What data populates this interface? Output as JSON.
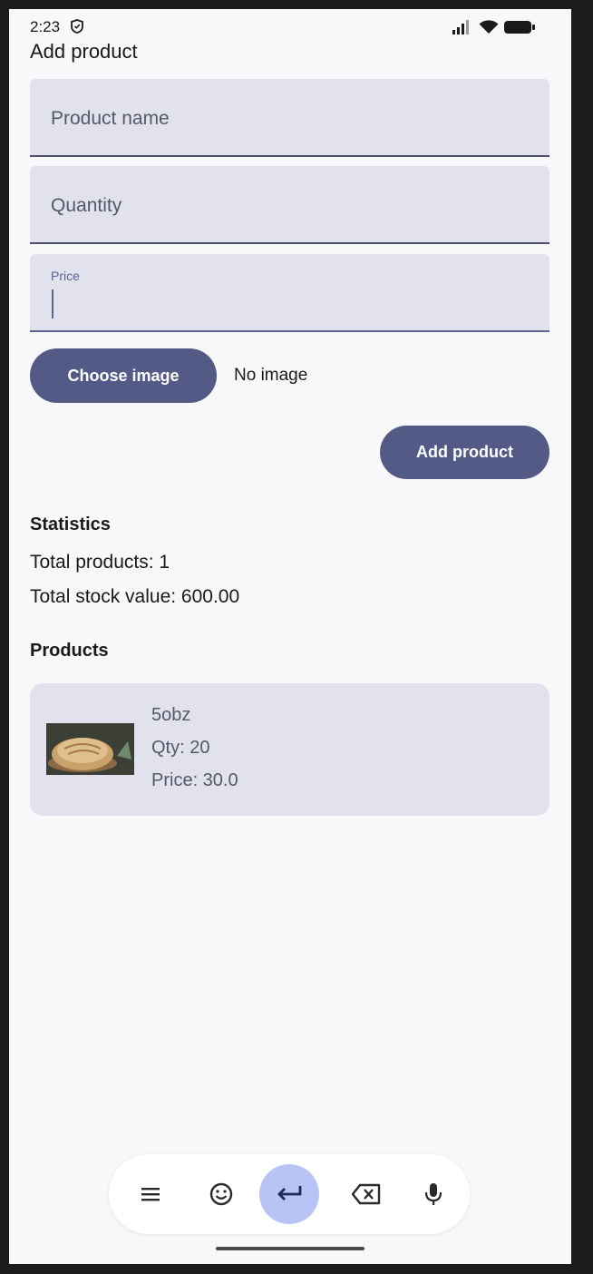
{
  "status_bar": {
    "time": "2:23",
    "icons": [
      "shield-icon",
      "signal-icon",
      "wifi-icon",
      "battery-icon"
    ]
  },
  "app_bar": {
    "title": "Add product"
  },
  "form": {
    "product_name_placeholder": "Product name",
    "quantity_placeholder": "Quantity",
    "price_label": "Price",
    "price_value": "",
    "choose_image_label": "Choose image",
    "image_status": "No image",
    "add_product_label": "Add product"
  },
  "statistics": {
    "title": "Statistics",
    "total_products": "Total products: 1",
    "total_stock_value": "Total stock value: 600.00"
  },
  "products": {
    "title": "Products",
    "items": [
      {
        "name": "5obz",
        "qty": "Qty: 20",
        "price": "Price: 30.0",
        "image": "bread-image"
      }
    ]
  },
  "keyboard_toolbar": {
    "icons": [
      "menu-icon",
      "emoji-icon",
      "enter-icon",
      "backspace-icon",
      "mic-icon"
    ]
  },
  "colors": {
    "primary": "#535a85",
    "field_bg": "#e2e2ef",
    "screen_bg": "#f8f8fa",
    "enter_key_bg": "#b8c4f5"
  }
}
